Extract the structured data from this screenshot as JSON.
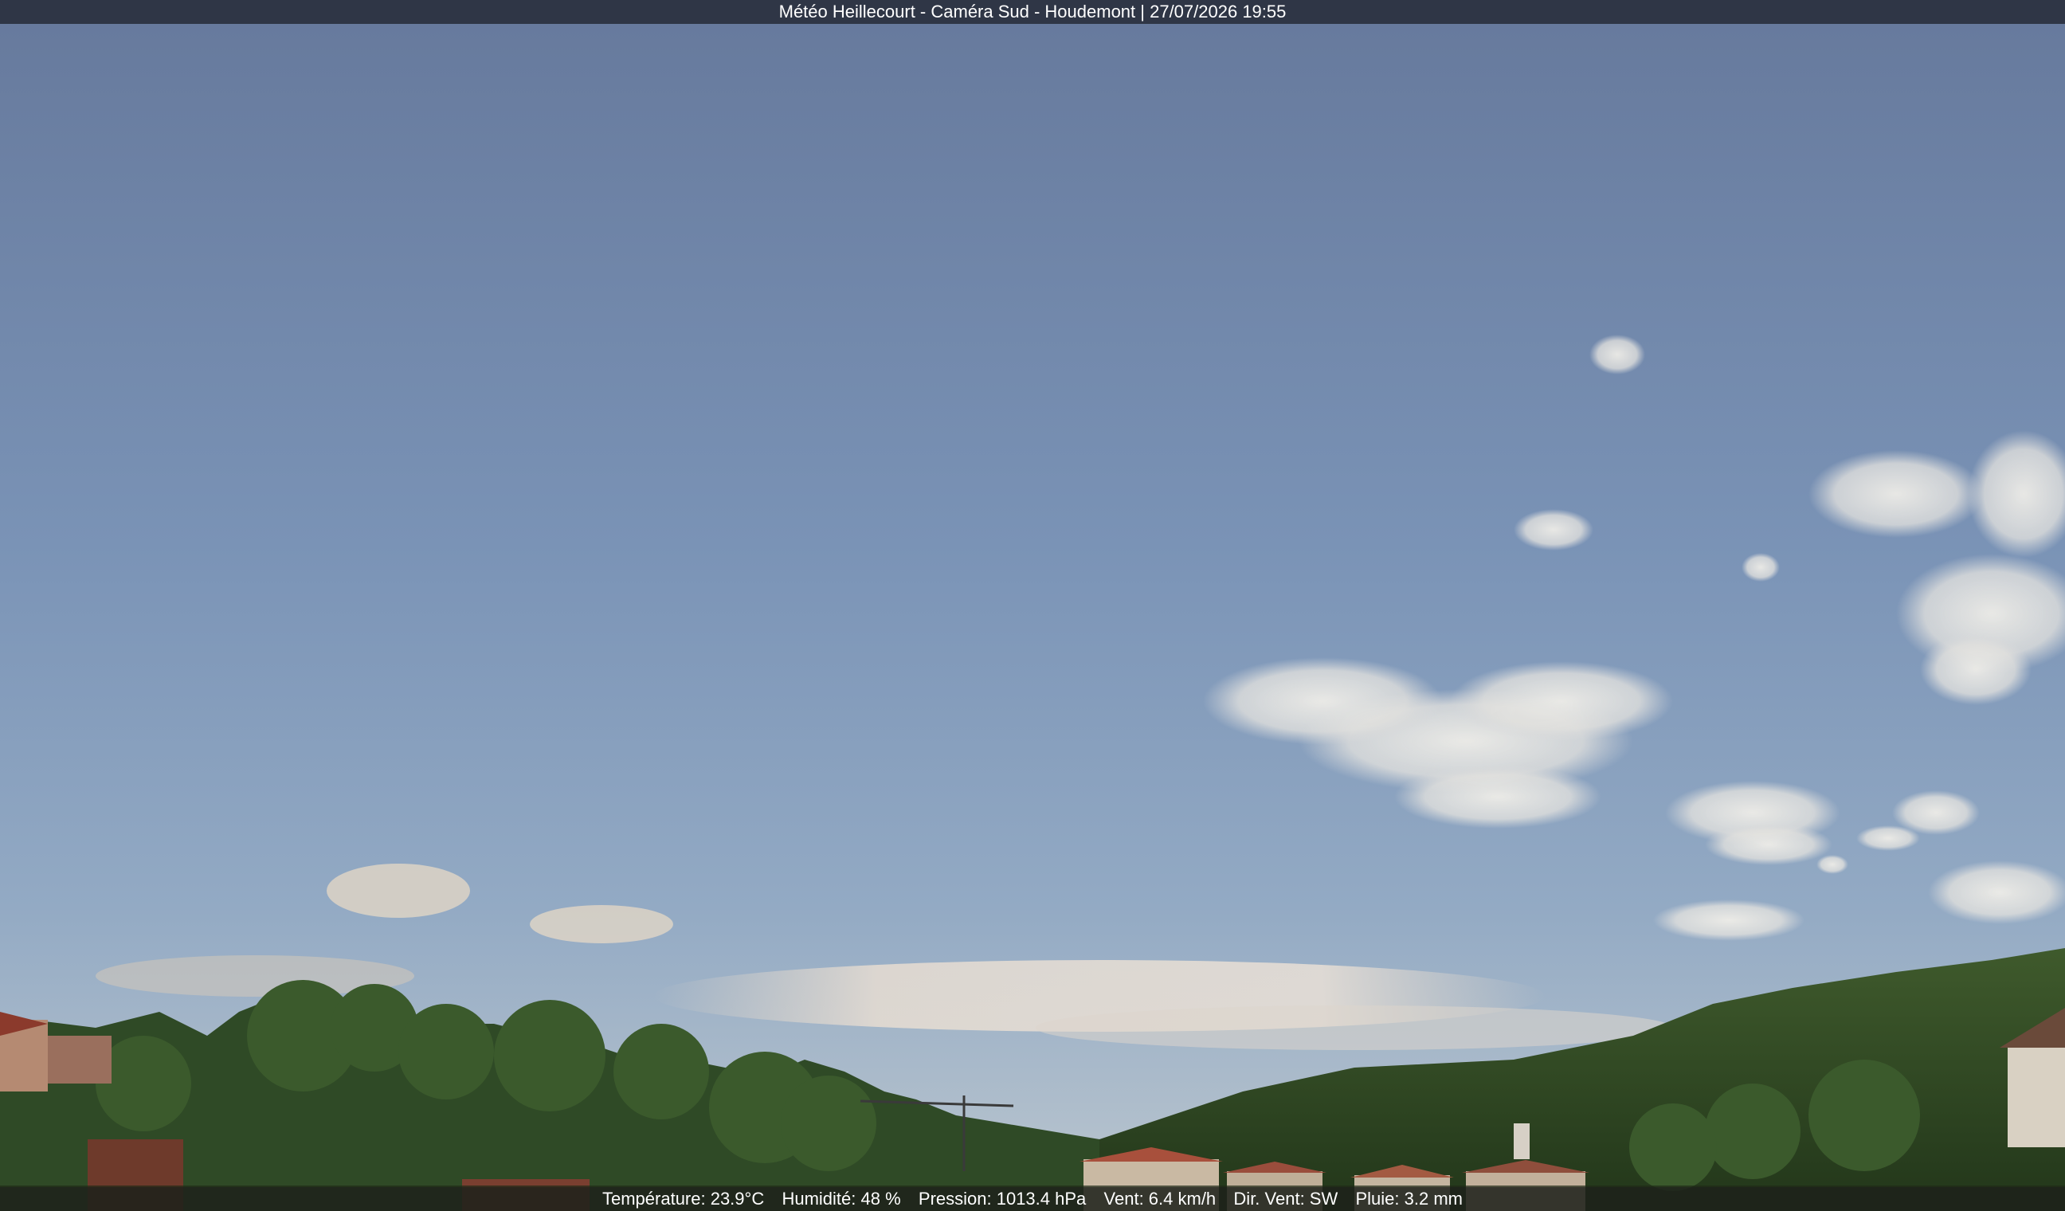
{
  "camera": {
    "title": "Météo Heillecourt - Caméra Sud - Houdemont | 27/07/2026 19:55"
  },
  "weather": {
    "temperature": "Température: 23.9°C",
    "humidity": "Humidité: 48 %",
    "pressure": "Pression: 1013.4 hPa",
    "wind": "Vent: 6.4 km/h",
    "wind_dir": "Dir. Vent: SW",
    "rain": "Pluie: 3.2 mm"
  },
  "colors": {
    "sky_top": "#6a7d9f",
    "sky_mid": "#7e98bc",
    "sky_horizon": "#b7c4cf",
    "vegetation": "#2e4a22",
    "banner": "#282c3a"
  }
}
